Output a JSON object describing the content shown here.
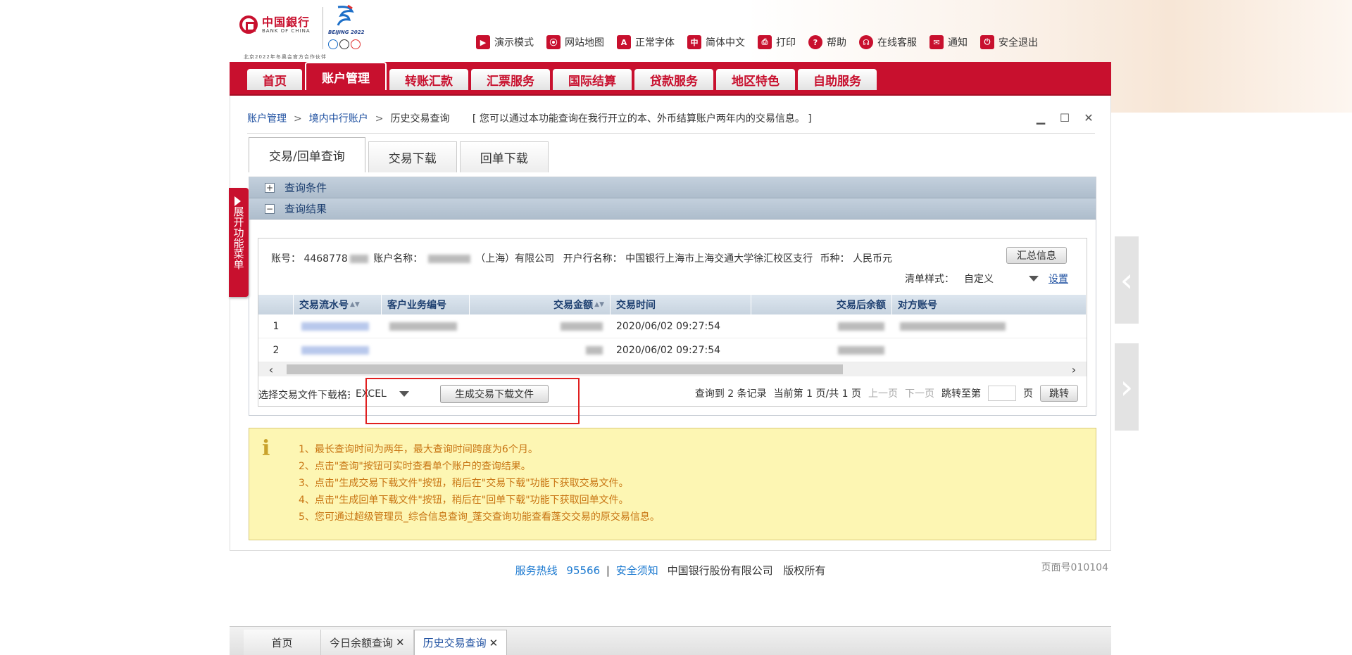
{
  "header": {
    "bank_name_cn": "中国銀行",
    "bank_name_en": "BANK OF CHINA",
    "olympic_text": "BEIJING 2022",
    "partner_text": "北京2022年冬奥会官方合作伙伴",
    "toplinks": [
      {
        "label": "演示模式",
        "icon": "film-icon",
        "glyph": "▶"
      },
      {
        "label": "网站地图",
        "icon": "map-pin-icon",
        "glyph": "⦿"
      },
      {
        "label": "正常字体",
        "icon": "font-icon",
        "glyph": "A"
      },
      {
        "label": "简体中文",
        "icon": "language-icon",
        "glyph": "中"
      },
      {
        "label": "打印",
        "icon": "printer-icon",
        "glyph": "⎙"
      },
      {
        "label": "帮助",
        "icon": "help-icon",
        "glyph": "?"
      },
      {
        "label": "在线客服",
        "icon": "headset-icon",
        "glyph": "☊"
      },
      {
        "label": "通知",
        "icon": "mail-icon",
        "glyph": "✉"
      },
      {
        "label": "安全退出",
        "icon": "lock-icon",
        "glyph": "⏻"
      }
    ]
  },
  "nav": {
    "tabs": [
      {
        "label": "首页"
      },
      {
        "label": "账户管理",
        "active": true
      },
      {
        "label": "转账汇款"
      },
      {
        "label": "汇票服务"
      },
      {
        "label": "国际结算"
      },
      {
        "label": "贷款服务"
      },
      {
        "label": "地区特色"
      },
      {
        "label": "自助服务"
      }
    ]
  },
  "breadcrumb": {
    "item1": "账户管理",
    "item2": "境内中行账户",
    "item3": "历史交易查询",
    "sep": ">",
    "note": "[ 您可以通过本功能查询在我行开立的本、外币结算账户两年内的交易信息。 ]"
  },
  "subtabs": [
    {
      "label": "交易/回单查询",
      "active": true
    },
    {
      "label": "交易下载"
    },
    {
      "label": "回单下载"
    }
  ],
  "sidebar_toggle": "展开功能菜单",
  "sections": {
    "query_conditions": "查询条件",
    "query_results": "查询结果"
  },
  "account": {
    "no_label": "账号：",
    "no_value": "4468778",
    "name_label": "账户名称：",
    "name_value": "（上海）有限公司",
    "bank_label": "开户行名称：",
    "bank_value": "中国银行上海市上海交通大学徐汇校区支行",
    "currency_label": "币种：",
    "currency_value": "人民币元",
    "summary_button": "汇总信息",
    "style_label": "清单样式：",
    "style_value": "自定义",
    "settings_link": "设置"
  },
  "table": {
    "columns": [
      "",
      "交易流水号",
      "客户业务编号",
      "交易金额",
      "交易时间",
      "交易后余额",
      "对方账号"
    ],
    "rows": [
      {
        "index": "1",
        "time": "2020/06/02 09:27:54"
      },
      {
        "index": "2",
        "time": "2020/06/02 09:27:54"
      }
    ]
  },
  "download": {
    "format_label": "选择交易文件下载格式",
    "format_value": "EXCEL",
    "generate_button": "生成交易下载文件"
  },
  "pager": {
    "total": "查询到 2 条记录",
    "current": "当前第 1 页/共 1 页",
    "prev": "上一页",
    "next": "下一页",
    "jump_label": "跳转至第",
    "page_unit": "页",
    "jump_button": "跳转"
  },
  "notice": {
    "items": [
      "1、最长查询时间为两年，最大查询时间跨度为6个月。",
      "2、点击\"查询\"按钮可实时查看单个账户的查询结果。",
      "3、点击\"生成交易下载文件\"按钮，稍后在\"交易下载\"功能下获取交易文件。",
      "4、点击\"生成回单下载文件\"按钮，稍后在\"回单下载\"功能下获取回单文件。",
      "5、您可通过超级管理员_综合信息查询_蓬交查询功能查看蓬交交易的原交易信息。"
    ]
  },
  "footer": {
    "hotline_label": "服务热线",
    "hotline_no": "95566",
    "safety": "安全须知",
    "company": "中国银行股份有限公司",
    "rights": "版权所有",
    "page_no": "页面号010104"
  },
  "taskbar": {
    "items": [
      {
        "label": "首页"
      },
      {
        "label": "今日余额查询",
        "closable": true
      },
      {
        "label": "历史交易查询",
        "closable": true,
        "active": true
      }
    ]
  }
}
